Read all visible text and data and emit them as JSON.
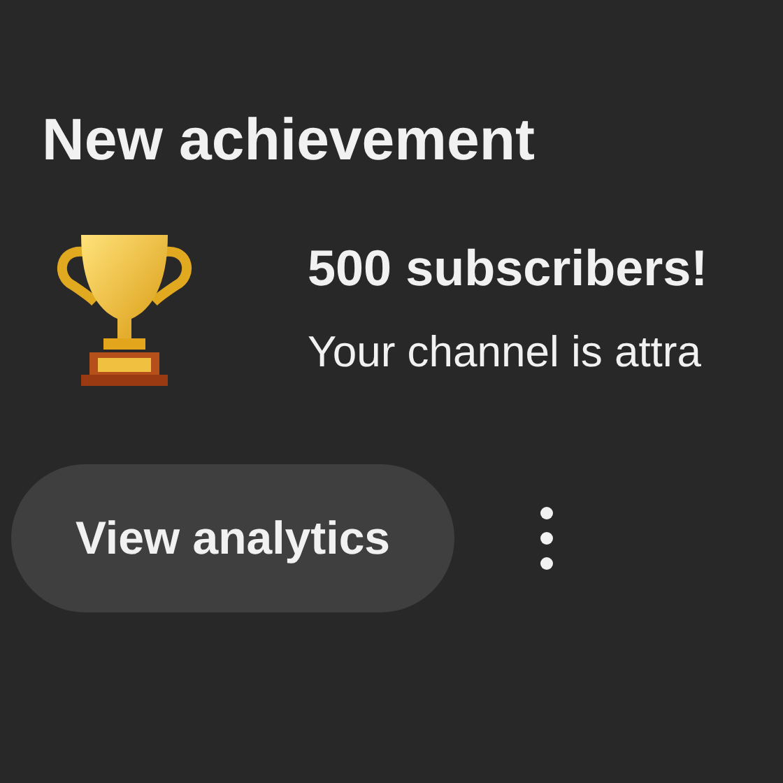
{
  "title": "New achievement",
  "achievement": {
    "heading": "500 subscribers!",
    "message": "Your channel is attra"
  },
  "actions": {
    "primary_button": "View analytics"
  }
}
